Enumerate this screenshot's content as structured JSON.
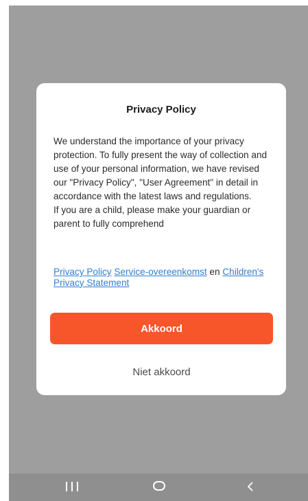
{
  "dialog": {
    "title": "Privacy Policy",
    "body_paragraphs": [
      "We understand the importance of your privacy protection. To fully present the way of collection and use of your personal information, we have revised our \"Privacy Policy\", \"User Agreement\" in detail in accordance with the latest laws and regulations.",
      "If you are a child, please make your guardian or parent to fully comprehend"
    ],
    "links": {
      "privacy_policy": "Privacy Policy",
      "service_agreement": "Service-overeenkomst",
      "conjunction": "en",
      "childrens_privacy": "Children's Privacy Statement"
    },
    "agree_label": "Akkoord",
    "decline_label": "Niet akkoord",
    "colors": {
      "agree_button": "#f7562a",
      "link": "#2f7fd3",
      "overlay": "#9e9e9e"
    }
  },
  "navbar": {
    "icons": [
      "recent-apps-icon",
      "home-icon",
      "back-icon"
    ]
  }
}
